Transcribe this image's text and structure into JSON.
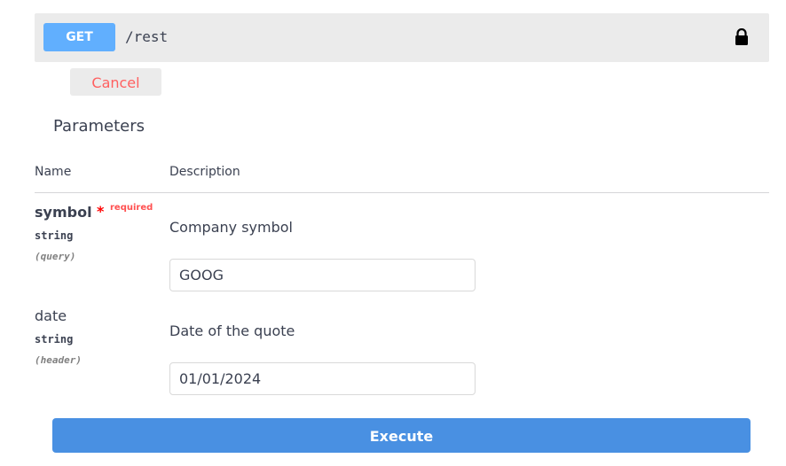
{
  "operation": {
    "method": "GET",
    "path": "/rest",
    "lock_icon": "lock-icon"
  },
  "cancel_label": "Cancel",
  "parameters_title": "Parameters",
  "columns": {
    "name": "Name",
    "description": "Description"
  },
  "params": [
    {
      "name": "symbol",
      "required_mark": "*",
      "required_label": "required",
      "type": "string",
      "in": "(query)",
      "description": "Company symbol",
      "value": "GOOG"
    },
    {
      "name": "date",
      "type": "string",
      "in": "(header)",
      "description": "Date of the quote",
      "value": "01/01/2024"
    }
  ],
  "execute_label": "Execute",
  "colors": {
    "method_bg": "#61affe",
    "execute_bg": "#4990e2",
    "cancel_text": "#ff6060",
    "required": "#ff0000"
  }
}
